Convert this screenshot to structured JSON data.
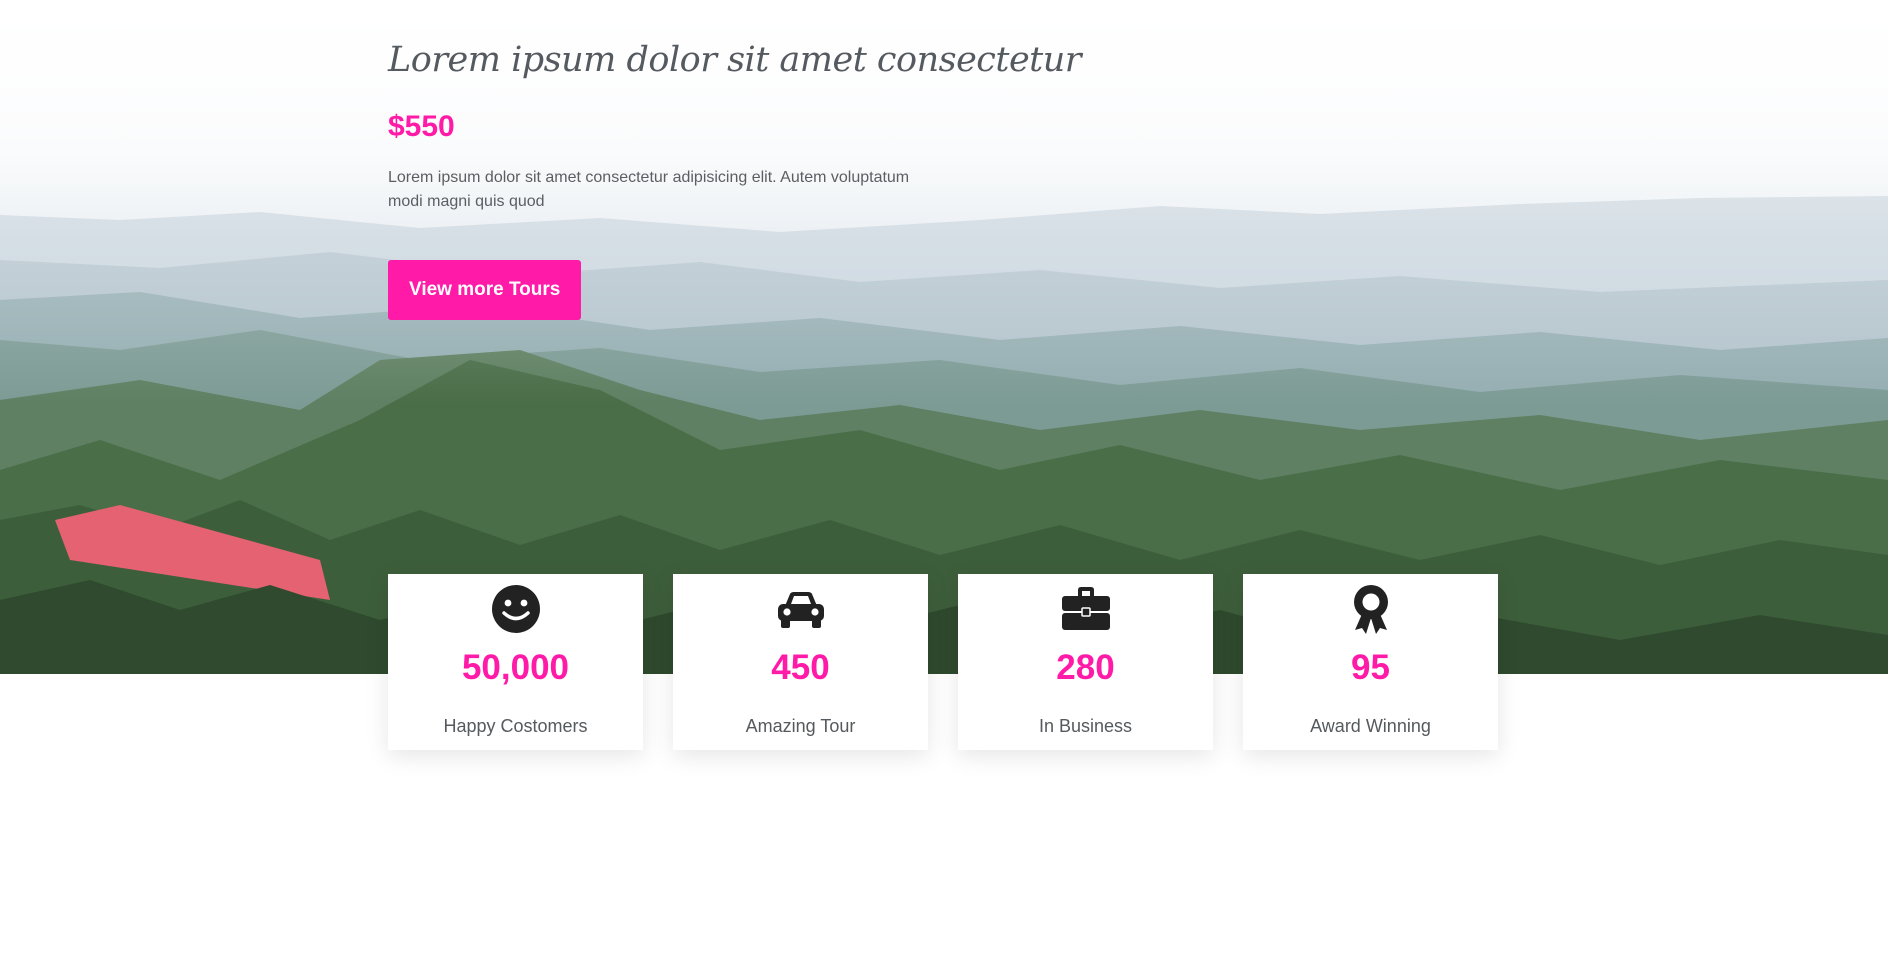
{
  "hero": {
    "title": "Lorem ipsum dolor sit amet consectetur",
    "price": "$550",
    "description": "Lorem ipsum dolor sit amet consectetur adipisicing elit. Autem voluptatum modi magni quis quod",
    "button_label": "View more Tours",
    "background": "misty green mountain forest landscape"
  },
  "colors": {
    "accent": "#ff1aa8",
    "text_dark": "#555a60"
  },
  "stats": [
    {
      "icon": "smile-icon",
      "value": "50,000",
      "label": "Happy Costomers"
    },
    {
      "icon": "car-icon",
      "value": "450",
      "label": "Amazing Tour"
    },
    {
      "icon": "briefcase-icon",
      "value": "280",
      "label": "In Business"
    },
    {
      "icon": "award-icon",
      "value": "95",
      "label": "Award Winning"
    }
  ]
}
